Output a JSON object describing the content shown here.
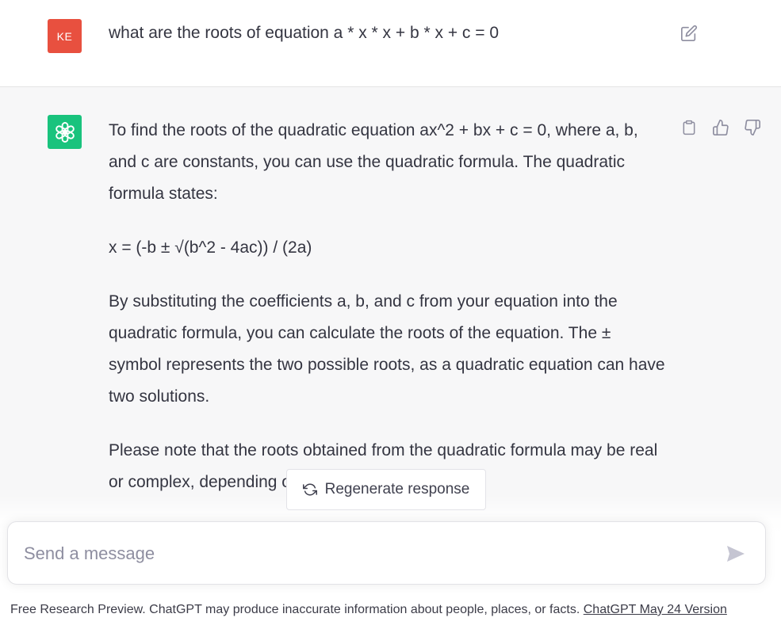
{
  "conversation": {
    "user": {
      "avatar_initials": "KE",
      "message": "what are the roots of equation a * x * x + b * x + c = 0"
    },
    "assistant": {
      "paragraphs": [
        "To find the roots of the quadratic equation ax^2 + bx + c = 0, where a, b, and c are constants, you can use the quadratic formula. The quadratic formula states:",
        "x = (-b ± √(b^2 - 4ac)) / (2a)",
        "By substituting the coefficients a, b, and c from your equation into the quadratic formula, you can calculate the roots of the equation. The ± symbol represents the two possible roots, as a quadratic equation can have two solutions.",
        "Please note that the roots obtained from the quadratic formula may be real or complex, depending on the values of a, b, and c."
      ]
    }
  },
  "regenerate": {
    "label": "Regenerate response"
  },
  "composer": {
    "placeholder": "Send a message",
    "value": ""
  },
  "footer": {
    "text": "Free Research Preview. ChatGPT may produce inaccurate information about people, places, or facts. ",
    "link_label": "ChatGPT May 24 Version"
  },
  "icons": {
    "edit": "edit-icon",
    "copy": "clipboard-icon",
    "thumbs_up": "thumbs-up-icon",
    "thumbs_down": "thumbs-down-icon",
    "regenerate": "refresh-icon",
    "send": "send-icon",
    "logo": "openai-logo-icon"
  },
  "colors": {
    "user_avatar": "#e8503f",
    "assistant_avatar": "#19c37d",
    "assistant_background": "#f7f7f8",
    "text": "#343541",
    "icon": "#8e8ea0"
  }
}
